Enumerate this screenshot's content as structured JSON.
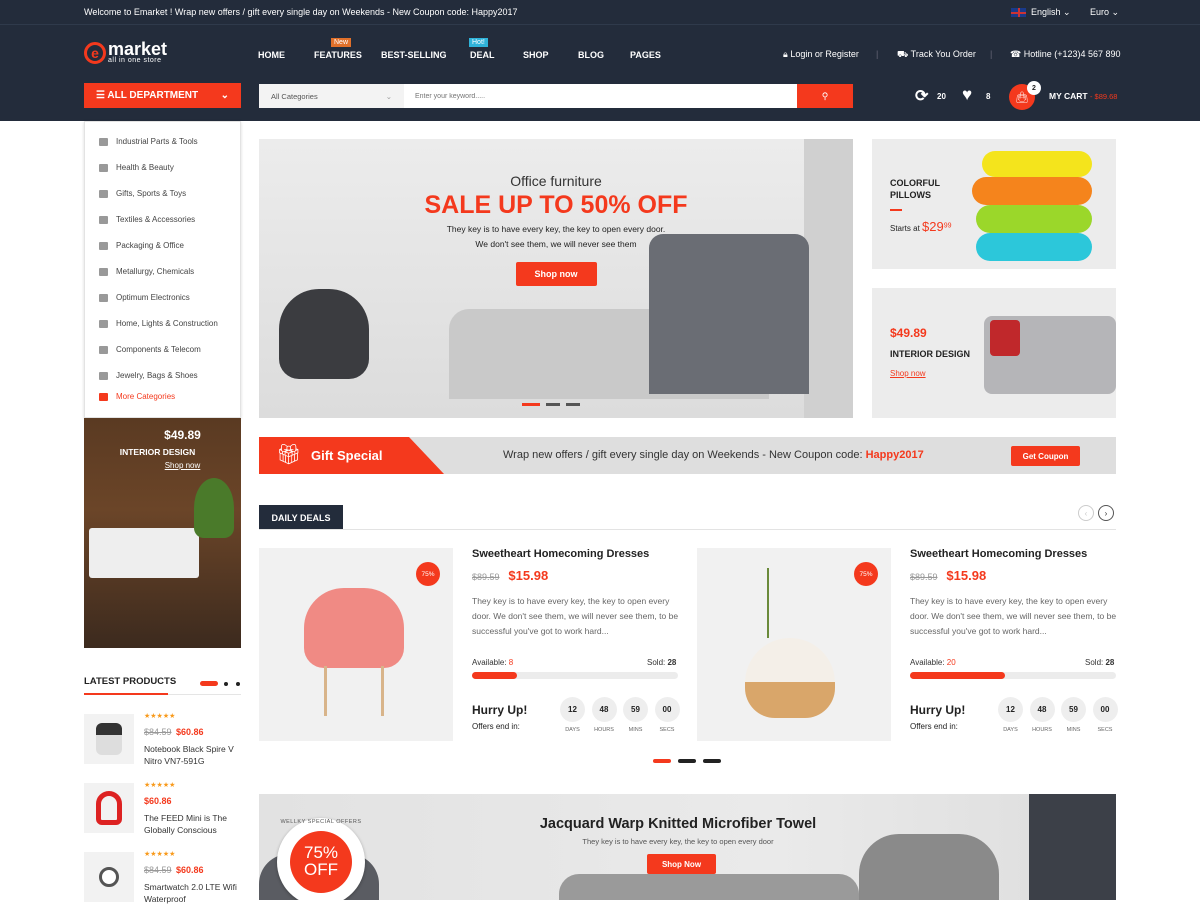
{
  "topbar": {
    "welcome": "Welcome to Emarket ! Wrap new offers / gift every single day on Weekends - New Coupon code: Happy2017",
    "language": "English",
    "currency": "Euro"
  },
  "logo": {
    "name": "market",
    "tagline": "all in one store"
  },
  "nav": [
    {
      "label": "HOME"
    },
    {
      "label": "FEATURES",
      "badge": "New"
    },
    {
      "label": "BEST-SELLING"
    },
    {
      "label": "DEAL",
      "badge": "Hot!"
    },
    {
      "label": "SHOP"
    },
    {
      "label": "BLOG"
    },
    {
      "label": "PAGES"
    }
  ],
  "header_links": {
    "login": "Login or Register",
    "track": "Track You Order",
    "hotline": "Hotline (+123)4 567 890"
  },
  "department": {
    "label": "ALL DEPARTMENT",
    "items": [
      "Industrial Parts & Tools",
      "Health & Beauty",
      "Gifts, Sports & Toys",
      "Textiles & Accessories",
      "Packaging & Office",
      "Metallurgy, Chemicals",
      "Optimum Electronics",
      "Home, Lights & Construction",
      "Components & Telecom",
      "Jewelry, Bags & Shoes"
    ],
    "more": "More Categories"
  },
  "search": {
    "category": "All Categories",
    "placeholder": "Enter your keyword....."
  },
  "header_counts": {
    "compare": "20",
    "wishlist": "8",
    "cart_count": "2",
    "cart_label": "MY CART",
    "cart_total": "- $89.68"
  },
  "colors": {
    "accent": "#f4391d",
    "dark": "#232c3b"
  },
  "hero": {
    "subtitle": "Office furniture",
    "title": "SALE UP TO 50% OFF",
    "line1": "They key is to have every key, the key to open every door.",
    "line2": "We don't see them, we will never see them",
    "button": "Shop now"
  },
  "promo1": {
    "title_line1": "COLORFUL",
    "title_line2": "PILLOWS",
    "starts": "Starts at",
    "price": "$29",
    "cents": "99"
  },
  "promo2": {
    "price": "$49.89",
    "title": "INTERIOR DESIGN",
    "link": "Shop now"
  },
  "side_banner": {
    "price": "$49.89",
    "title": "INTERIOR DESIGN",
    "link": "Shop now"
  },
  "gift": {
    "label": "Gift Special",
    "text": "Wrap new offers / gift every single day on Weekends - New Coupon code:",
    "code": "Happy2017",
    "button": "Get Coupon"
  },
  "daily_deals": {
    "title": "DAILY DEALS",
    "items": [
      {
        "discount": "75%",
        "name": "Sweetheart Homecoming Dresses",
        "old_price": "$89.59",
        "price": "$15.98",
        "desc": "They key is to have every key, the key to open every door. We don't see them, we will never see them, to be successful you've got to work hard...",
        "available_label": "Available:",
        "available": "8",
        "sold_label": "Sold:",
        "sold": "28",
        "progress": 0.22,
        "hurry": "Hurry Up!",
        "ends": "Offers end in:",
        "countdown": [
          {
            "v": "12",
            "l": "DAYS"
          },
          {
            "v": "48",
            "l": "HOURS"
          },
          {
            "v": "59",
            "l": "MINS"
          },
          {
            "v": "00",
            "l": "SECS"
          }
        ]
      },
      {
        "discount": "75%",
        "name": "Sweetheart Homecoming Dresses",
        "old_price": "$89.59",
        "price": "$15.98",
        "desc": "They key is to have every key, the key to open every door. We don't see them, we will never see them, to be successful you've got to work hard...",
        "available_label": "Available:",
        "available": "20",
        "sold_label": "Sold:",
        "sold": "28",
        "progress": 0.46,
        "hurry": "Hurry Up!",
        "ends": "Offers end in:",
        "countdown": [
          {
            "v": "12",
            "l": "DAYS"
          },
          {
            "v": "48",
            "l": "HOURS"
          },
          {
            "v": "59",
            "l": "MINS"
          },
          {
            "v": "00",
            "l": "SECS"
          }
        ]
      }
    ]
  },
  "latest": {
    "title": "LATEST PRODUCTS",
    "items": [
      {
        "stars": "★★★★★",
        "old_price": "$84.59",
        "price": "$60.86",
        "name": "Notebook Black Spire V Nitro VN7-591G"
      },
      {
        "stars": "★★★★★",
        "old_price": "",
        "price": "$60.86",
        "name": "The FEED Mini is The Globally Conscious"
      },
      {
        "stars": "★★★★★",
        "old_price": "$84.59",
        "price": "$60.86",
        "name": "Smartwatch 2.0 LTE Wifi Waterproof"
      }
    ]
  },
  "bottom_banner": {
    "title": "Jacquard Warp Knitted Microfiber Towel",
    "subtitle": "They key is to have every key, the key to open every door",
    "button": "Shop Now",
    "sticker": "75%",
    "sticker2": "OFF",
    "sticker_ring": "WELLKY SPECIAL OFFERS"
  }
}
